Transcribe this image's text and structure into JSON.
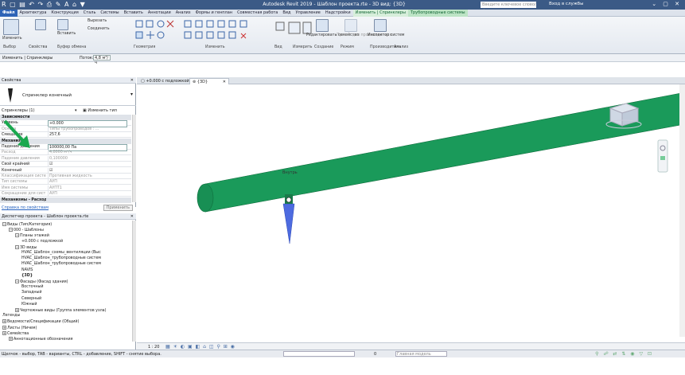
{
  "app": {
    "title": "Autodesk Revit 2019 - Шаблон проекта.rte - 3D вид: {3D}",
    "search_placeholder": "Введите ключевое слово/фразу",
    "sign_in": "Вход в службы",
    "help": "?"
  },
  "ribbon_tabs": [
    "Файл",
    "Архитектура",
    "Конструкция",
    "Сталь",
    "Системы",
    "Вставить",
    "Аннотации",
    "Анализ",
    "Формы и генплан",
    "Совместная работа",
    "Вид",
    "Управление",
    "Надстройки",
    "Изменить | Спринклеры",
    "Трубопроводные системы"
  ],
  "ribbon": {
    "modify": "Изменить",
    "insert": "Вставить",
    "cut": "Вырезать",
    "join": "Соединить",
    "reconnect": "Редактировать семейство",
    "replace": "Проект для производителя",
    "inspector": "Инспектор систем",
    "groups": [
      "Выбор",
      "Свойства",
      "Буфер обмена",
      "Геометрия",
      "Изменить",
      "Вид",
      "Измерить",
      "Создание",
      "Режим",
      "Производитель",
      "Анализ"
    ]
  },
  "context_bar": {
    "label": "Изменить | Спринклеры",
    "flow_label": "Поток:",
    "flow_value": "4,8 м³/ч"
  },
  "properties": {
    "title": "Свойства",
    "type_name": "Спринклер конечный",
    "selector": "Спринклеры (1)",
    "edit_type": "Изменить тип",
    "rows": [
      {
        "k": "Зависимости",
        "v": "",
        "cat": true
      },
      {
        "k": "Уровень",
        "v": "+0.000",
        "edit": true
      },
      {
        "k": "Основа",
        "v": "Типы трубопроводов : ...",
        "grey": true
      },
      {
        "k": "Смещение",
        "v": "257,6"
      },
      {
        "k": "Механизмы",
        "v": "",
        "cat": true
      },
      {
        "k": "Падение давления",
        "v": "100000,00 Па",
        "edit": true
      },
      {
        "k": "Расход",
        "v": "4,8000 м³/ч",
        "grey": true
      },
      {
        "k": "Падение давления",
        "v": "0,100000",
        "grey": true
      },
      {
        "k": "Свой крайний",
        "v": "☑"
      },
      {
        "k": "Конечный",
        "v": "☑"
      },
      {
        "k": "Классификация системы",
        "v": "Противная жидкость",
        "grey": true
      },
      {
        "k": "Тип системы",
        "v": "АУП",
        "grey": true
      },
      {
        "k": "Имя системы",
        "v": "АУПТ1",
        "grey": true
      },
      {
        "k": "Сокращение для сист...",
        "v": "АУП",
        "grey": true
      },
      {
        "k": "Механизмы - Расход",
        "v": "",
        "cat": true
      }
    ],
    "help_link": "Справка по свойствам",
    "apply": "Применить"
  },
  "browser": {
    "title": "Диспетчер проекта - Шаблон проекта.rte",
    "nodes": [
      {
        "t": "Виды (Тип/Категория)",
        "d": 0,
        "pm": "-"
      },
      {
        "t": "000 - Шаблоны",
        "d": 1,
        "pm": "-"
      },
      {
        "t": "Планы этажей",
        "d": 2,
        "pm": "-"
      },
      {
        "t": "+0.000 с подложкой",
        "d": 3
      },
      {
        "t": "3D виды",
        "d": 2,
        "pm": "-"
      },
      {
        "t": "HVAC_Шаблон_схемы_вентиляции (Выс",
        "d": 3
      },
      {
        "t": "HVAC_Шаблон_трубопроводные систем",
        "d": 3
      },
      {
        "t": "HVAC_Шаблон_трубопроводные систем",
        "d": 3
      },
      {
        "t": "NAVIS",
        "d": 3
      },
      {
        "t": "{3D}",
        "d": 3,
        "bold": true
      },
      {
        "t": "Фасады (Фасад здания)",
        "d": 2,
        "pm": "-"
      },
      {
        "t": "Восточный",
        "d": 3
      },
      {
        "t": "Западный",
        "d": 3
      },
      {
        "t": "Северный",
        "d": 3
      },
      {
        "t": "Южный",
        "d": 3
      },
      {
        "t": "Чертежные виды (Группа элементов узла)",
        "d": 2,
        "pm": "+"
      },
      {
        "t": "Легенды",
        "d": 0
      },
      {
        "t": "Ведомости/Спецификации (Общий)",
        "d": 0,
        "pm": "+"
      },
      {
        "t": "Листы (Ничем)",
        "d": 0,
        "pm": "+"
      },
      {
        "t": "Семейства",
        "d": 0,
        "pm": "+"
      },
      {
        "t": "Аннотационные обозначения",
        "d": 1,
        "pm": "+"
      }
    ]
  },
  "view_tabs": [
    "+0.000 с подложкой",
    "{3D}"
  ],
  "viewport": {
    "tag_label": "Внутрь"
  },
  "view_control": {
    "scale": "1 : 20"
  },
  "status": {
    "message": "Щелчок - выбор, TAB - варианты, CTRL - добавление, SHIFT - снятие выбора.",
    "model_placeholder": "Главная модель",
    "zero": "0"
  },
  "colors": {
    "pipe": "#1a9a5a",
    "pipe_dark": "#0f6e3d",
    "arrow": "#1aa84e",
    "titlebar": "#3b5a86"
  }
}
